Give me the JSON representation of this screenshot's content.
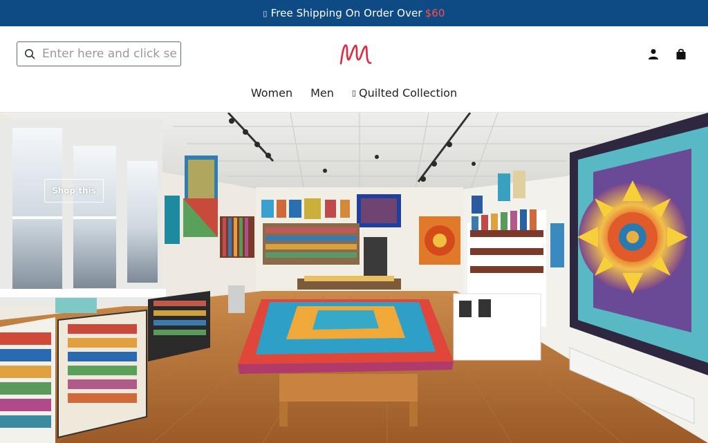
{
  "announcement": {
    "glyph": "▯",
    "text": "Free Shipping On Order Over",
    "price": "$60"
  },
  "search": {
    "placeholder": "Enter here and click search"
  },
  "brand": {
    "logo_icon": "m-script-logo",
    "logo_color": "#e0283b"
  },
  "header_icons": [
    {
      "name": "account-icon"
    },
    {
      "name": "bag-icon"
    }
  ],
  "nav": {
    "items": [
      {
        "label": "Women"
      },
      {
        "label": "Men"
      },
      {
        "label": "Quilted Collection",
        "glyph": "▯"
      }
    ]
  },
  "hero": {
    "cta_label": "Shop this",
    "image_description_icon": "quilt-shop-interior-photo"
  },
  "colors": {
    "announcement_bg": "#0e4b84",
    "price_accent": "#ff4d4d"
  }
}
